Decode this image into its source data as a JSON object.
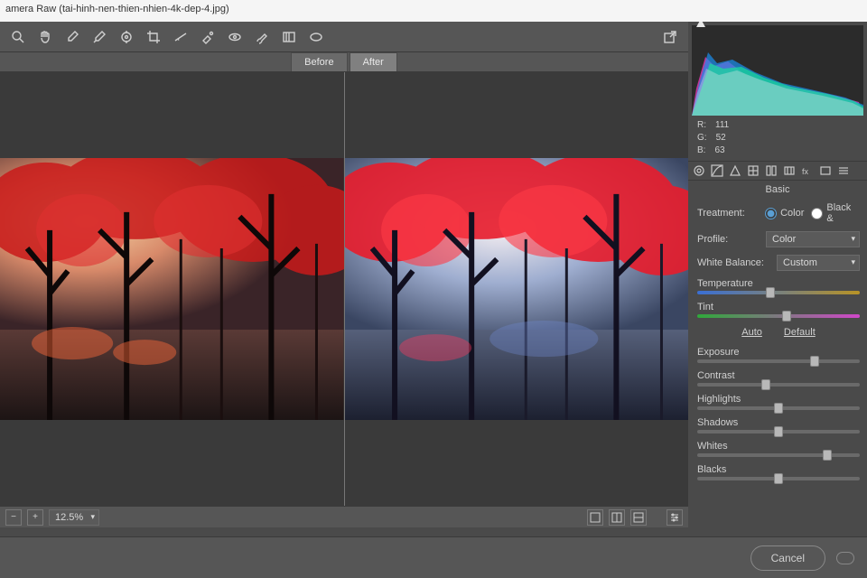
{
  "title": "amera Raw (tai-hinh-nen-thien-nhien-4k-dep-4.jpg)",
  "tabs": {
    "before": "Before",
    "after": "After"
  },
  "zoom": "12.5%",
  "rgb": {
    "r_label": "R:",
    "r": "111",
    "g_label": "G:",
    "g": "52",
    "b_label": "B:",
    "b": "63"
  },
  "panel": {
    "title": "Basic",
    "treatment_label": "Treatment:",
    "treatment_color": "Color",
    "treatment_bw": "Black &",
    "profile_label": "Profile:",
    "profile_value": "Color",
    "wb_label": "White Balance:",
    "wb_value": "Custom",
    "temperature": "Temperature",
    "tint": "Tint",
    "auto": "Auto",
    "default": "Default",
    "exposure": "Exposure",
    "contrast": "Contrast",
    "highlights": "Highlights",
    "shadows": "Shadows",
    "whites": "Whites",
    "blacks": "Blacks"
  },
  "footer": {
    "cancel": "Cancel"
  },
  "sliders": {
    "temperature": 45,
    "tint": 55,
    "exposure": 72,
    "contrast": 42,
    "highlights": 50,
    "shadows": 50,
    "whites": 80,
    "blacks": 50
  }
}
